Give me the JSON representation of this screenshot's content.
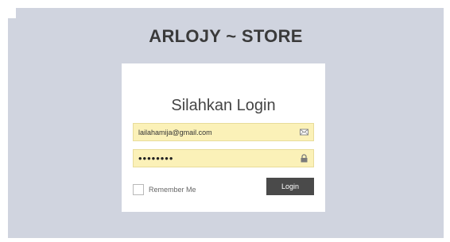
{
  "header": {
    "store_title": "ARLOJY ~ STORE"
  },
  "login_form": {
    "heading": "Silahkan Login",
    "email": {
      "value": "lailahamija@gmail.com",
      "icon": "envelope-icon"
    },
    "password": {
      "masked_value": "••••••••",
      "icon": "lock-icon"
    },
    "remember_label": "Remember Me",
    "remember_checked": false,
    "submit_label": "Login"
  },
  "colors": {
    "page_background": "#d0d4df",
    "card_background": "#ffffff",
    "input_background": "#fbf1b8",
    "button_background": "#4a4a4a",
    "button_text": "#ffffff"
  }
}
